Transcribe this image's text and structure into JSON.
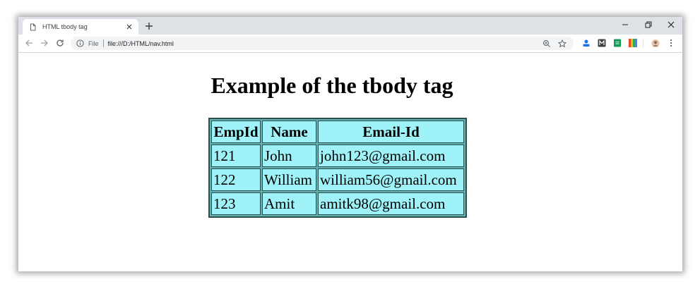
{
  "browser": {
    "tab_title": "HTML tbody tag",
    "address_scheme": "File",
    "address_url": "file:///D:/HTML/nav.html",
    "extensions": [
      "account-icon",
      "m-icon",
      "green-sheet-icon",
      "color-bars-icon",
      "avatar-icon"
    ]
  },
  "page": {
    "heading": "Example of the tbody tag",
    "table": {
      "headers": [
        "EmpId",
        "Name",
        "Email-Id"
      ],
      "rows": [
        [
          "121",
          "John",
          "john123@gmail.com"
        ],
        [
          "122",
          "William",
          "william56@gmail.com"
        ],
        [
          "123",
          "Amit",
          "amitk98@gmail.com"
        ]
      ]
    }
  },
  "colors": {
    "cell_background": "#9ff3f8",
    "border": "#2f4f4f",
    "tabstrip": "#dee1e6"
  }
}
